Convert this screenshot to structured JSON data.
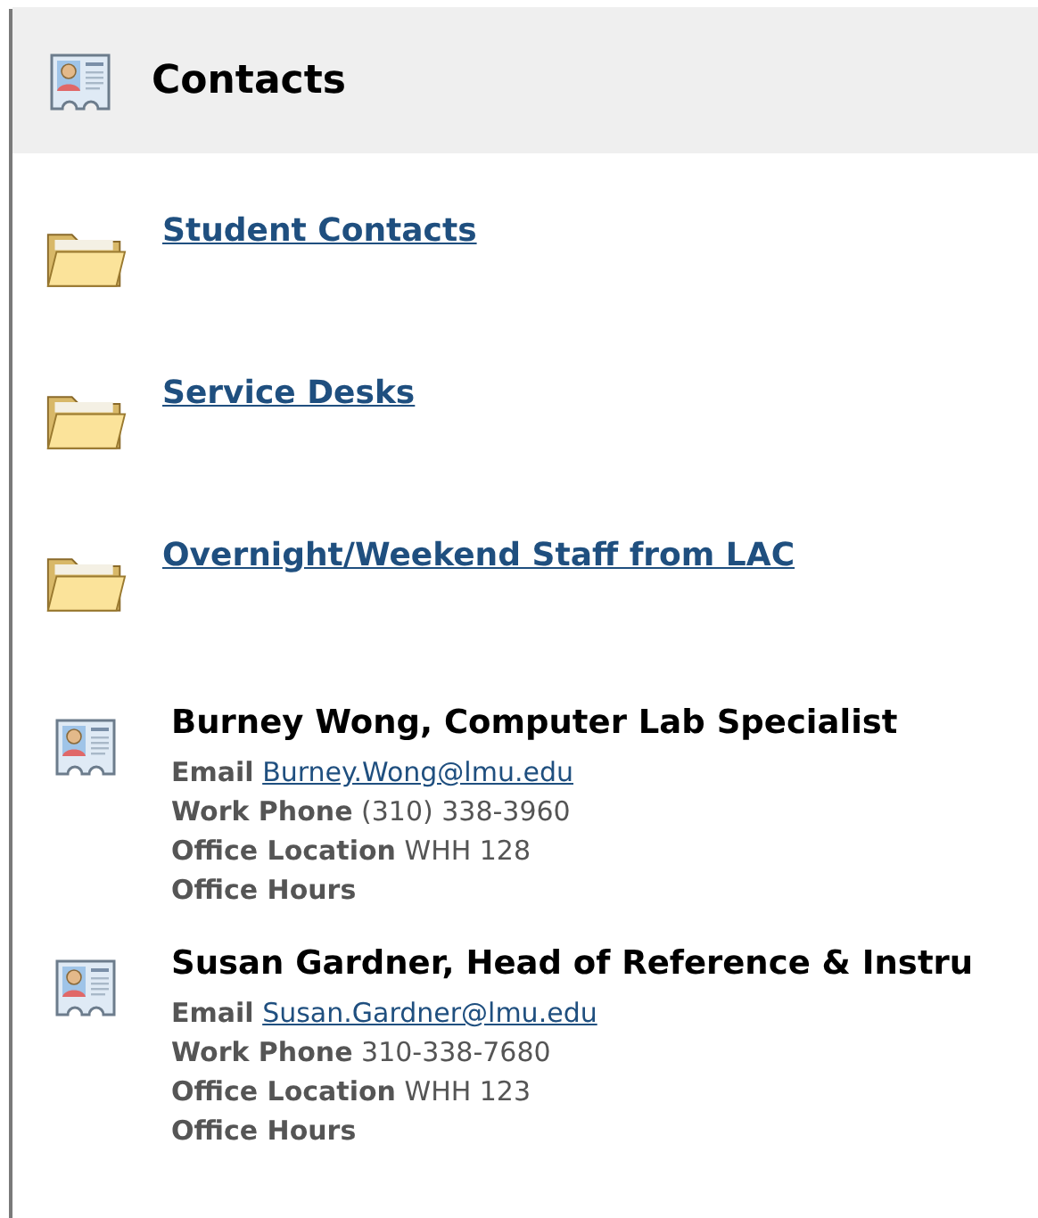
{
  "header": {
    "title": "Contacts"
  },
  "folders": [
    {
      "label": "Student Contacts"
    },
    {
      "label": "Service Desks"
    },
    {
      "label": "Overnight/Weekend Staff from LAC"
    }
  ],
  "contacts": [
    {
      "name": "Burney Wong, Computer Lab Specialist",
      "fields": [
        {
          "label": "Email",
          "value": "Burney.Wong@lmu.edu",
          "kind": "link"
        },
        {
          "label": "Work Phone",
          "value": "(310) 338-3960",
          "kind": "text"
        },
        {
          "label": "Office Location",
          "value": "WHH 128",
          "kind": "text"
        },
        {
          "label": "Office Hours"
        }
      ]
    },
    {
      "name": "Susan Gardner, Head of Reference & Instru",
      "fields": [
        {
          "label": "Email",
          "value": "Susan.Gardner@lmu.edu",
          "kind": "link"
        },
        {
          "label": "Work Phone",
          "value": "310-338-7680",
          "kind": "text"
        },
        {
          "label": "Office Location",
          "value": "WHH 123",
          "kind": "text"
        },
        {
          "label": "Office Hours"
        }
      ]
    }
  ]
}
